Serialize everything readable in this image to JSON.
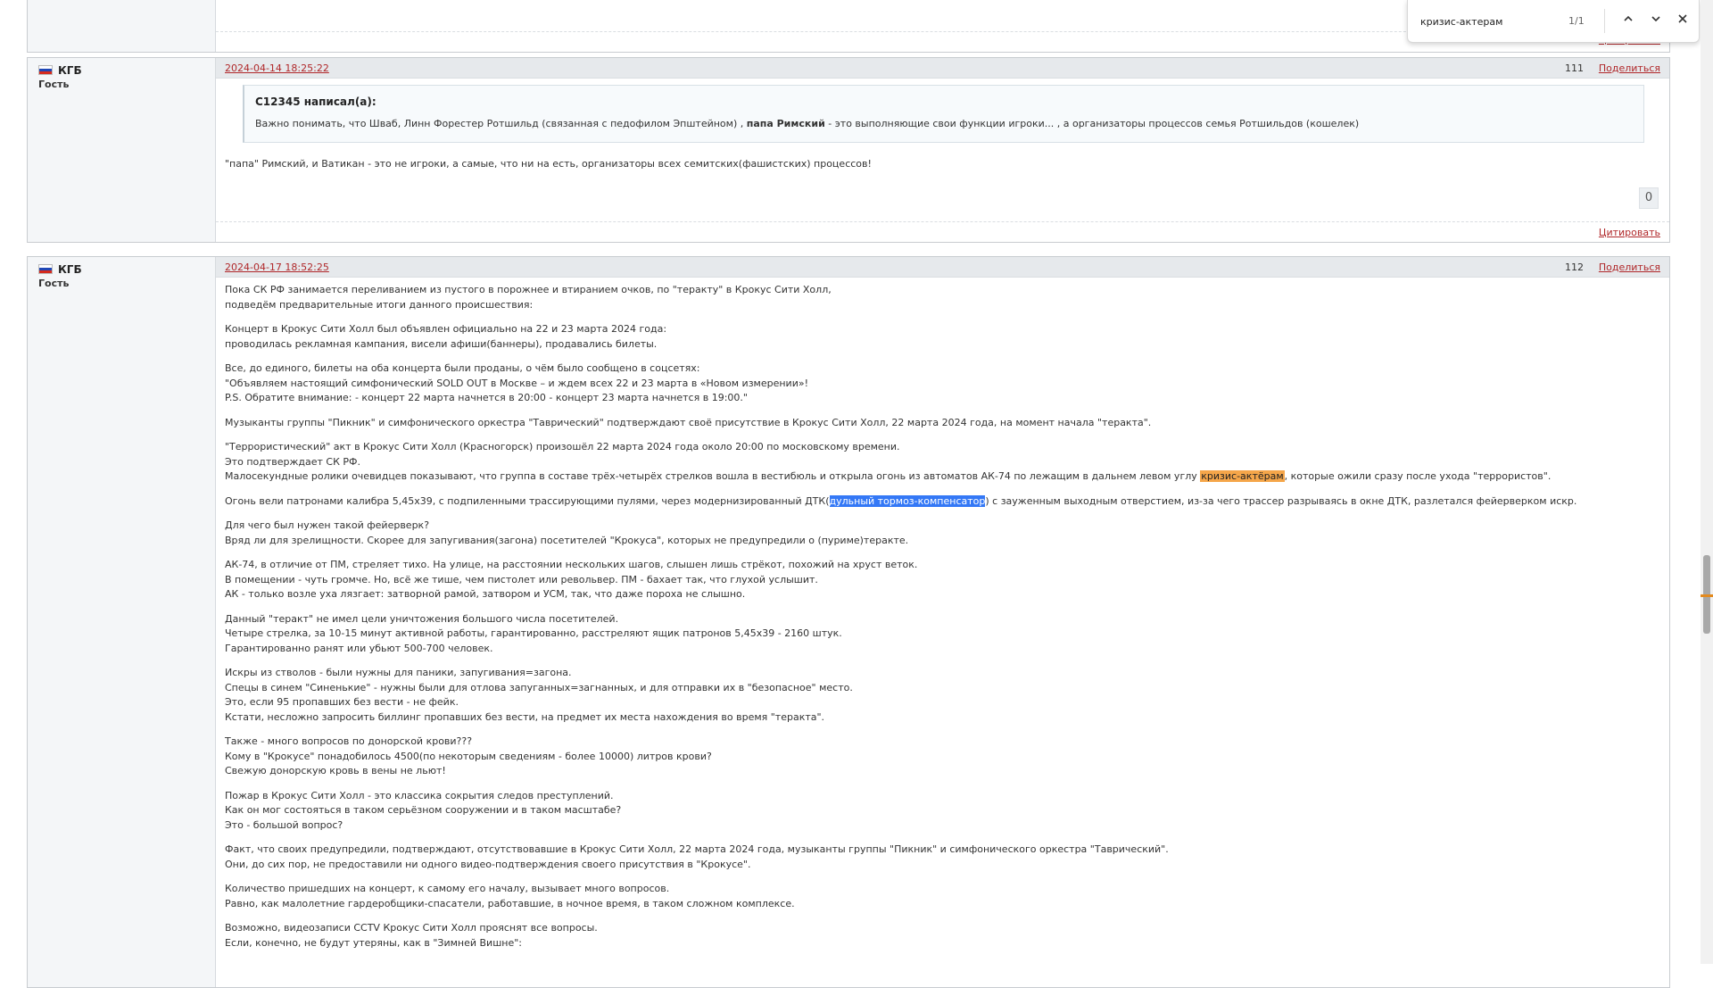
{
  "findbar": {
    "query": "кризис-актерам",
    "count": "1/1"
  },
  "post0": {
    "quote_link": "Цитировать"
  },
  "post1": {
    "flag": "russia-flag",
    "author": "КГБ",
    "role": "Гость",
    "date": "2024-04-14 18:25:22",
    "number": "111",
    "share": "Поделиться",
    "quote_author": "C12345 написал(а):",
    "quote_text_before": "Важно понимать, что Шваб, Линн Форестер Ротшильд (связанная с педофилом Эпштейном) , ",
    "quote_text_bold": "папа Римский",
    "quote_text_after": " -  это  выполняющие свои функции игроки... ,  а организаторы процессов  семья Ротшильдов (кошелек)",
    "text": "\"папа\" Римский, и Ватикан - это не игроки, а самые, что ни на есть, организаторы всех семитских(фашистских) процессов!",
    "rating": "0",
    "quote_link": "Цитировать"
  },
  "post2": {
    "flag": "russia-flag",
    "author": "КГБ",
    "role": "Гость",
    "date": "2024-04-17 18:52:25",
    "number": "112",
    "share": "Поделиться",
    "p1_l1": "Пока СК РФ занимается переливанием из пустого в порожнее и втиранием очков, по \"теракту\" в Крокус Сити Холл,",
    "p1_l2": "подведём предварительные итоги данного происшествия:",
    "p2_l1": "Концерт в Крокус Сити Холл был объявлен официально на 22 и 23 марта 2024 года:",
    "p2_l2": "проводилась рекламная кампания, висели афиши(баннеры), продавались билеты.",
    "p3_l1": "Все, до единого, билеты на оба концерта были проданы, о чём было сообщено в соцсетях:",
    "p3_l2": "\"Объявляем настоящий симфонический SOLD OUT в Москве – и ждем всех 22 и 23 марта в «Новом измерении»!",
    "p3_l3": "P.S. Обратите внимание: - концерт 22 марта  начнется в 20:00 - концерт 23 марта начнется в 19:00.\"",
    "p4_l1": "Музыканты группы \"Пикник\" и симфонического оркестра \"Таврический\" подтверждают своё присутствие в Крокус Сити Холл, 22 марта 2024 года, на момент начала \"теракта\".",
    "p5_l1": "\"Террористический\" акт в Крокус Сити Холл (Красногорск) произошёл 22 марта 2024 года около 20:00 по московскому времени.",
    "p5_l2": "Это подтверждает СК РФ.",
    "p5_l3_before": "Малосекундные ролики очевидцев показывают, что группа в составе трёх-четырёх стрелков  вошла в вестибюль и открыла огонь из автоматов АК-74 по лежащим в дальнем левом углу ",
    "p5_l3_match": "кризис-актёрам",
    "p5_l3_after": ", которые ожили сразу после ухода \"террористов\".",
    "p6_before": "Огонь вели патронами калибра 5,45x39, с подпиленными трассирующими пулями, через модернизированный ДТК(",
    "p6_sel": "дульный тормоз-компенсатор",
    "p6_after": ") с зауженным выходным отверстием, из-за чего трассер разрываясь в окне ДТК, разлетался фейерверком искр.",
    "p7_l1": "Для чего был нужен такой фейерверк?",
    "p7_l2": "Вряд ли для зрелищности. Скорее для запугивания(загона) посетителей \"Крокуса\", которых не предупредили о (пуриме)теракте.",
    "p8_l1": "АК-74, в отличие от ПМ, стреляет тихо. На улице, на расстоянии нескольких шагов, слышен лишь стрёкот, похожий на хруст веток.",
    "p8_l2": "В помещении - чуть громче. Но, всё же тише, чем пистолет или револьвер. ПМ - бахает так, что глухой услышит.",
    "p8_l3": "АК - только возле уха лязгает: затворной рамой, затвором и УСМ, так, что даже пороха не слышно.",
    "p9_l1": "Данный \"теракт\" не имел цели уничтожения большого числа посетителей.",
    "p9_l2": "Четыре стрелка, за 10-15 минут активной работы, гарантированно, расстреляют ящик патронов 5,45x39 - 2160 штук.",
    "p9_l3": "Гарантированно ранят или убьют 500-700 человек.",
    "p10_l1": "Искры из стволов - были нужны для паники, запугивания=загона.",
    "p10_l2": "Спецы в синем \"Синенькие\" - нужны были для отлова запуганных=загнанных, и для отправки их в \"безопасное\" место.",
    "p10_l3": "Это, если 95 пропавших без вести - не фейк.",
    "p10_l4": "Кстати, несложно запросить биллинг пропавших без вести, на предмет их места нахождения во время \"теракта\".",
    "p11_l1": "Также - много вопросов по донорской крови???",
    "p11_l2": "Кому в \"Крокусе\" понадобилось 4500(по некоторым сведениям - более 10000) литров крови?",
    "p11_l3": "Свежую донорскую кровь в вены не льют!",
    "p12_l1": "Пожар в Крокус Сити Холл - это классика сокрытия следов преступлений.",
    "p12_l2": "Как он мог состояться в таком серьёзном сооружении и в таком масштабе?",
    "p12_l3": "Это - большой вопрос?",
    "p13_l1": "Факт, что своих предупредили, подтверждают, отсутствовавшие в Крокус Сити Холл, 22 марта 2024 года, музыканты группы \"Пикник\" и симфонического оркестра \"Таврический\".",
    "p13_l2": "Они, до сих пор, не предоставили ни одного видео-подтверждения своего присутствия в \"Крокусе\".",
    "p14_l1": "Количество пришедших на концерт, к самому его началу, вызывает много вопросов.",
    "p14_l2": "Равно, как малолетние гардеробщики-спасатели, работавшие, в ночное время, в таком сложном комплексе.",
    "p15_l1": "Возможно, видеозаписи CCTV Крокус Сити Холл прояснят все вопросы.",
    "p15_l2": "Если, конечно, не будут утеряны, как в \"Зимней Вишне\":"
  }
}
